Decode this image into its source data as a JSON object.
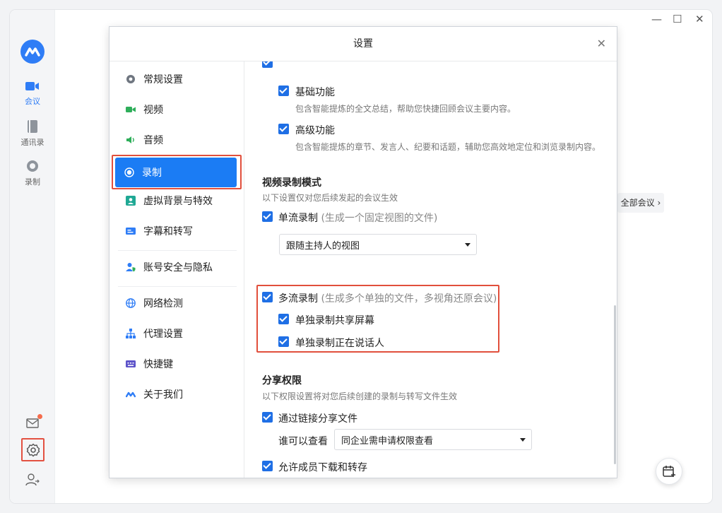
{
  "window": {
    "minimize": "—",
    "maximize": "☐",
    "close": "✕"
  },
  "rail": {
    "items": [
      {
        "label": "会议"
      },
      {
        "label": "通讯录"
      },
      {
        "label": "录制"
      }
    ]
  },
  "dialog": {
    "title": "设置",
    "close": "✕",
    "nav": [
      {
        "label": "常规设置"
      },
      {
        "label": "视频"
      },
      {
        "label": "音频"
      },
      {
        "label": "录制"
      },
      {
        "label": "虚拟背景与特效"
      },
      {
        "label": "字幕和转写"
      },
      {
        "label": "账号安全与隐私"
      },
      {
        "label": "网络检测"
      },
      {
        "label": "代理设置"
      },
      {
        "label": "快捷键"
      },
      {
        "label": "关于我们"
      }
    ],
    "smart": {
      "basic": "基础功能",
      "basic_desc": "包含智能提炼的全文总结，帮助您快捷回顾会议主要内容。",
      "advanced": "高级功能",
      "advanced_desc": "包含智能提炼的章节、发言人、纪要和话题，辅助您高效地定位和浏览录制内容。"
    },
    "video_mode": {
      "title": "视频录制模式",
      "desc": "以下设置仅对您后续发起的会议生效",
      "single": "单流录制",
      "single_hint": "(生成一个固定视图的文件)",
      "view_select": "跟随主持人的视图",
      "multi": "多流录制",
      "multi_hint": "(生成多个单独的文件，多视角还原会议)",
      "share_screen": "单独录制共享屏幕",
      "speaker": "单独录制正在说话人"
    },
    "share": {
      "title": "分享权限",
      "desc": "以下权限设置将对您后续创建的录制与转写文件生效",
      "via_link": "通过链接分享文件",
      "who_label": "谁可以查看",
      "who_value": "同企业需申请权限查看",
      "allow_download": "允许成员下载和转存"
    }
  },
  "background": {
    "all_meetings": "全部会议"
  },
  "colors": {
    "accent": "#1b7cf4",
    "highlight": "#e14f3c"
  }
}
